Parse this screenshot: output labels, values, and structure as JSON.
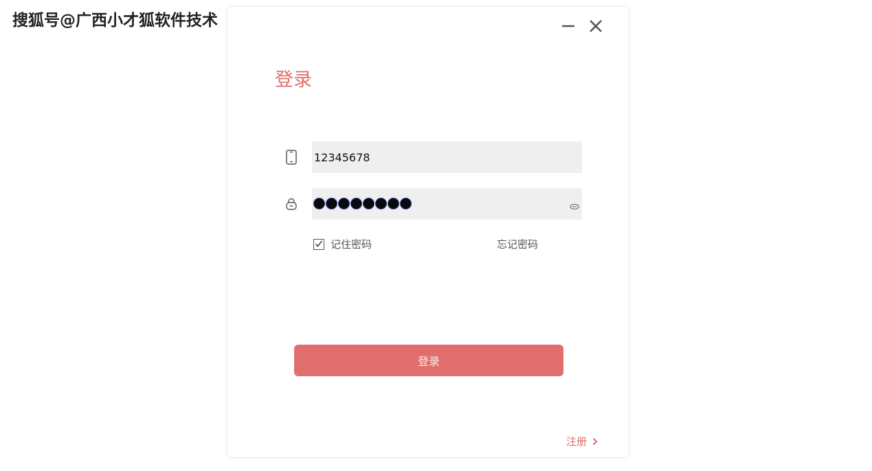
{
  "watermark": {
    "text": "搜狐号@广西小才狐软件技术"
  },
  "window": {
    "title": "登录",
    "controls": {
      "minimize": "minimize-icon",
      "close": "close-icon"
    }
  },
  "form": {
    "phone": {
      "value": "12345678",
      "icon": "phone-icon"
    },
    "password": {
      "masked_length": 8,
      "icon": "lock-icon",
      "toggle_icon": "eye-icon"
    },
    "remember": {
      "label": "记住密码",
      "checked": true
    },
    "forgot_label": "忘记密码",
    "submit_label": "登录"
  },
  "footer": {
    "register_label": "注册",
    "register_icon": "chevron-right-icon"
  },
  "colors": {
    "accent": "#df6e6c",
    "field_bg": "#efefef",
    "text_gray": "#555555"
  }
}
